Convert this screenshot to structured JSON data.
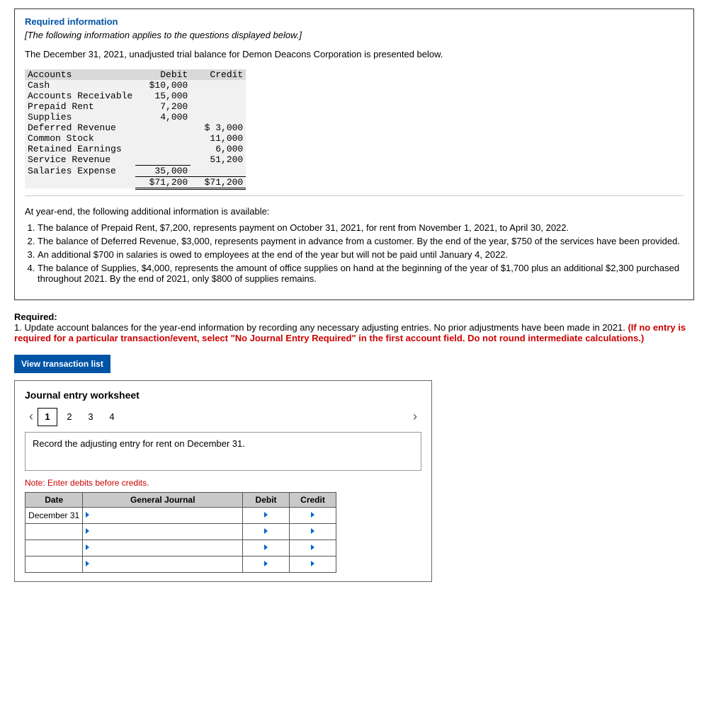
{
  "required_info_label": "Required information",
  "instructions_italic": "[The following information applies to the questions displayed below.]",
  "intro": "The December 31, 2021, unadjusted trial balance for Demon Deacons Corporation is presented below.",
  "trial_balance": {
    "headers": [
      "Accounts",
      "Debit",
      "Credit"
    ],
    "rows": [
      {
        "acct": "Cash",
        "debit": "$10,000",
        "credit": ""
      },
      {
        "acct": "Accounts Receivable",
        "debit": "15,000",
        "credit": ""
      },
      {
        "acct": "Prepaid Rent",
        "debit": "7,200",
        "credit": ""
      },
      {
        "acct": "Supplies",
        "debit": "4,000",
        "credit": ""
      },
      {
        "acct": "Deferred Revenue",
        "debit": "",
        "credit": "$ 3,000"
      },
      {
        "acct": "Common Stock",
        "debit": "",
        "credit": "11,000"
      },
      {
        "acct": "Retained Earnings",
        "debit": "",
        "credit": "6,000"
      },
      {
        "acct": "Service Revenue",
        "debit": "",
        "credit": "51,200"
      },
      {
        "acct": "Salaries Expense",
        "debit": "35,000",
        "credit": ""
      }
    ],
    "totals": {
      "debit": "$71,200",
      "credit": "$71,200"
    }
  },
  "available_intro": "At year-end, the following additional information is available:",
  "facts": [
    "The balance of Prepaid Rent, $7,200, represents payment on October 31, 2021, for rent from November 1, 2021, to April 30, 2022.",
    "The balance of  Deferred Revenue, $3,000, represents payment in advance from a customer. By the end of the year, $750 of the services have been provided.",
    "An additional $700 in salaries is owed to employees at the end of the year but will not be paid until January 4, 2022.",
    "The balance of Supplies, $4,000, represents the amount of office supplies on hand at the beginning of the year of $1,700 plus an additional $2,300 purchased throughout 2021. By the end of 2021, only $800 of supplies remains."
  ],
  "required_label": "Required:",
  "required_text_lead": "1. Update account balances for the year-end information by recording any necessary adjusting entries. No prior adjustments have been made in 2021. ",
  "required_text_red": "(If no entry is required for a particular transaction/event, select \"No Journal Entry Required\" in the first account field. Do not round intermediate calculations.)",
  "view_btn": "View transaction list",
  "worksheet": {
    "title": "Journal entry worksheet",
    "steps": [
      "1",
      "2",
      "3",
      "4"
    ],
    "active_step": 0,
    "instruction": "Record the adjusting entry for rent on December 31.",
    "note": "Note: Enter debits before credits.",
    "headers": [
      "Date",
      "General Journal",
      "Debit",
      "Credit"
    ],
    "date_cell": "December 31"
  }
}
